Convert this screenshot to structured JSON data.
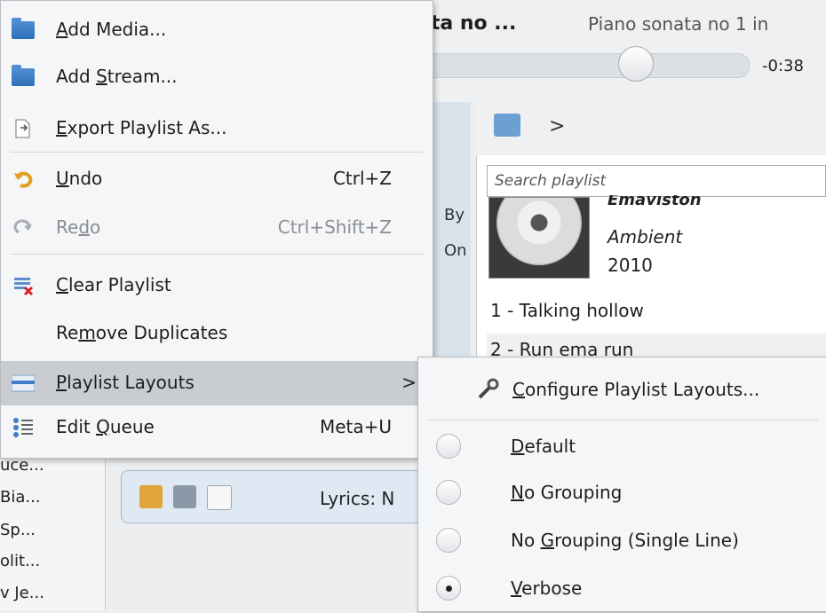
{
  "now_playing": {
    "title": "ata no ...",
    "next": "Piano sonata no 1 in",
    "time_remaining": "-0:38",
    "progress": 0.62
  },
  "context": {
    "by": "By",
    "on": "On"
  },
  "left_list": [
    "uce...",
    "Bia...",
    "Sp...",
    "olit...",
    "v Je..."
  ],
  "lyrics_bar": {
    "label": "Lyrics: N"
  },
  "playlist": {
    "chevron": ">",
    "search_placeholder": "Search playlist",
    "album": {
      "artist": "Emaviston",
      "genre": "Ambient",
      "year": "2010"
    },
    "tracks": [
      "1 - Talking hollow",
      "2 - Run ema run"
    ]
  },
  "menu": {
    "items": [
      {
        "pre": "",
        "ul": "A",
        "post": "dd Media...",
        "shortcut": "",
        "icon": "folder-icon",
        "disabled": false
      },
      {
        "pre": "Add ",
        "ul": "S",
        "post": "tream...",
        "shortcut": "",
        "icon": "folder-icon",
        "disabled": false
      },
      {
        "pre": "",
        "ul": "E",
        "post": "xport Playlist As...",
        "shortcut": "",
        "icon": "export-icon",
        "disabled": false
      },
      {
        "pre": "",
        "ul": "U",
        "post": "ndo",
        "shortcut": "Ctrl+Z",
        "icon": "undo-icon",
        "disabled": false
      },
      {
        "pre": "Re",
        "ul": "d",
        "post": "o",
        "shortcut": "Ctrl+Shift+Z",
        "icon": "redo-icon",
        "disabled": true
      },
      {
        "pre": "",
        "ul": "C",
        "post": "lear Playlist",
        "shortcut": "",
        "icon": "clear-playlist-icon",
        "disabled": false
      },
      {
        "pre": "Re",
        "ul": "m",
        "post": "ove Duplicates",
        "shortcut": "",
        "icon": "",
        "disabled": false
      },
      {
        "pre": "",
        "ul": "P",
        "post": "laylist Layouts",
        "shortcut": "",
        "icon": "layout-icon",
        "disabled": false,
        "submenu_arrow": ">"
      },
      {
        "pre": "Edit ",
        "ul": "Q",
        "post": "ueue",
        "shortcut": "Meta+U",
        "icon": "queue-icon",
        "disabled": false
      }
    ]
  },
  "submenu": {
    "configure": {
      "pre": "",
      "ul": "C",
      "post": "onfigure Playlist Layouts..."
    },
    "layouts": [
      {
        "pre": "",
        "ul": "D",
        "post": "efault",
        "selected": false
      },
      {
        "pre": "",
        "ul": "N",
        "post": "o Grouping",
        "selected": false
      },
      {
        "pre": "No ",
        "ul": "G",
        "post": "rouping (Single Line)",
        "selected": false
      },
      {
        "pre": "",
        "ul": "V",
        "post": "erbose",
        "selected": true
      }
    ]
  },
  "colors": {
    "highlight": "#c9cdd1",
    "menu_bg": "#f5f6f7",
    "accent": "#2e6fb8"
  }
}
